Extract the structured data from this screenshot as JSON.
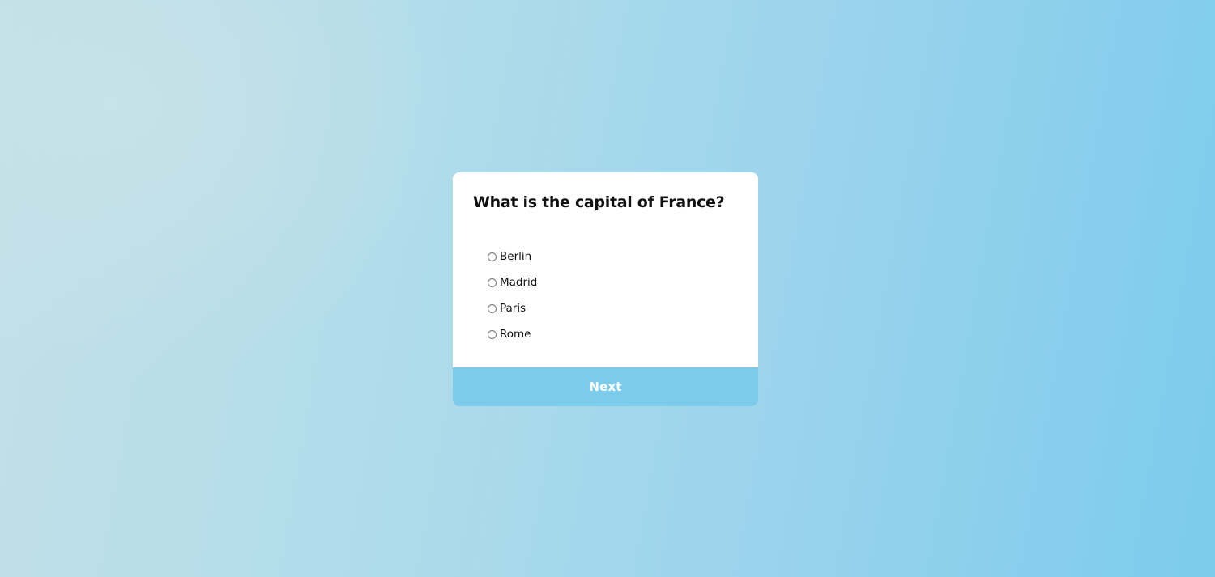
{
  "quiz": {
    "question": "What is the capital of France?",
    "options": [
      {
        "label": "Berlin",
        "selected": false
      },
      {
        "label": "Madrid",
        "selected": false
      },
      {
        "label": "Paris",
        "selected": false
      },
      {
        "label": "Rome",
        "selected": false
      }
    ],
    "next_label": "Next"
  },
  "colors": {
    "accent": "#7dcbeb",
    "card_background": "#ffffff",
    "background_start": "#c3e0e8",
    "background_end": "#7ccbec"
  }
}
